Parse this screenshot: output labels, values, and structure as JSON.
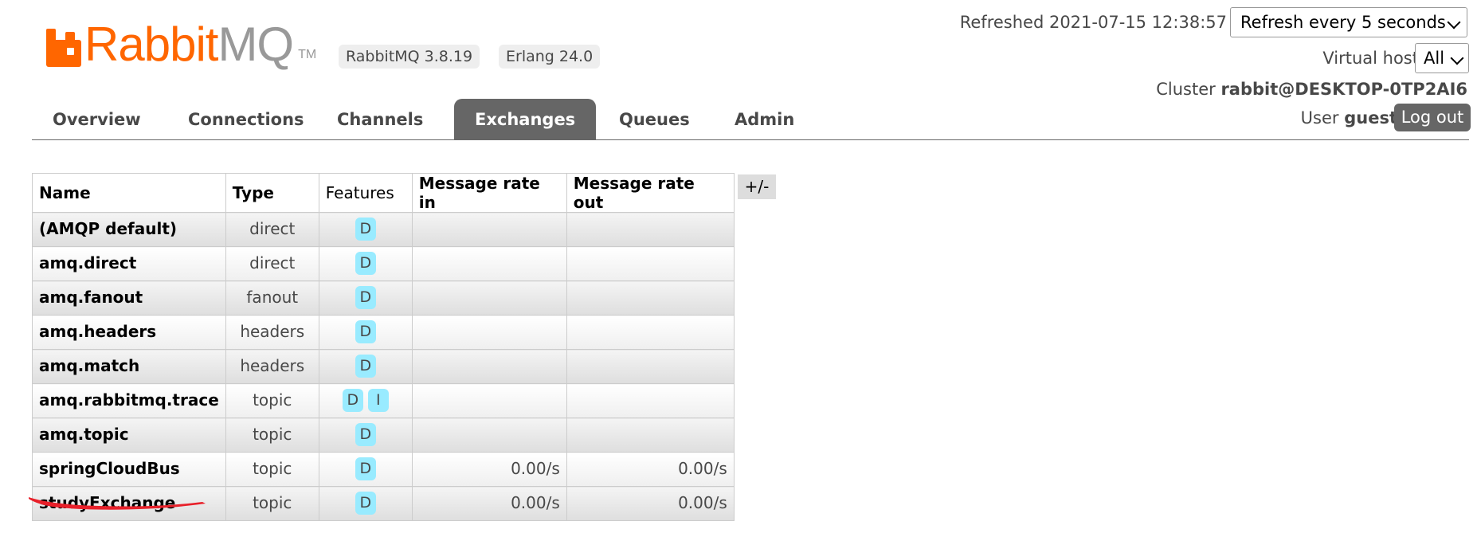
{
  "header": {
    "logo_rabbit": "Rabbit",
    "logo_mq": "MQ",
    "logo_tm": "TM",
    "version_rabbitmq": "RabbitMQ 3.8.19",
    "version_erlang": "Erlang 24.0",
    "refreshed_label": "Refreshed 2021-07-15 12:38:57",
    "refresh_option": "Refresh every 5 seconds",
    "vhost_label": "Virtual host",
    "vhost_value": "All",
    "cluster_label": "Cluster",
    "cluster_value": "rabbit@DESKTOP-0TP2AI6",
    "user_label": "User",
    "user_value": "guest",
    "logout_label": "Log out"
  },
  "nav": {
    "tabs": [
      {
        "label": "Overview"
      },
      {
        "label": "Connections"
      },
      {
        "label": "Channels"
      },
      {
        "label": "Exchanges",
        "active": true
      },
      {
        "label": "Queues"
      },
      {
        "label": "Admin"
      }
    ]
  },
  "table": {
    "columns": [
      "Name",
      "Type",
      "Features",
      "Message rate in",
      "Message rate out"
    ],
    "toggle_label": "+/-",
    "rows": [
      {
        "name": "(AMQP default)",
        "type": "direct",
        "features": [
          "D"
        ],
        "rate_in": "",
        "rate_out": ""
      },
      {
        "name": "amq.direct",
        "type": "direct",
        "features": [
          "D"
        ],
        "rate_in": "",
        "rate_out": ""
      },
      {
        "name": "amq.fanout",
        "type": "fanout",
        "features": [
          "D"
        ],
        "rate_in": "",
        "rate_out": ""
      },
      {
        "name": "amq.headers",
        "type": "headers",
        "features": [
          "D"
        ],
        "rate_in": "",
        "rate_out": ""
      },
      {
        "name": "amq.match",
        "type": "headers",
        "features": [
          "D"
        ],
        "rate_in": "",
        "rate_out": ""
      },
      {
        "name": "amq.rabbitmq.trace",
        "type": "topic",
        "features": [
          "D",
          "I"
        ],
        "rate_in": "",
        "rate_out": ""
      },
      {
        "name": "amq.topic",
        "type": "topic",
        "features": [
          "D"
        ],
        "rate_in": "",
        "rate_out": ""
      },
      {
        "name": "springCloudBus",
        "type": "topic",
        "features": [
          "D"
        ],
        "rate_in": "0.00/s",
        "rate_out": "0.00/s"
      },
      {
        "name": "studyExchange",
        "type": "topic",
        "features": [
          "D"
        ],
        "rate_in": "0.00/s",
        "rate_out": "0.00/s"
      }
    ]
  },
  "colors": {
    "brand_orange": "#ff6600",
    "tab_active": "#666666",
    "feature_badge": "#99ebff",
    "annotation_red": "#e8202a"
  },
  "icons": {
    "logo": "rabbit-logo-icon",
    "select_arrow": "chevron-down-icon"
  }
}
